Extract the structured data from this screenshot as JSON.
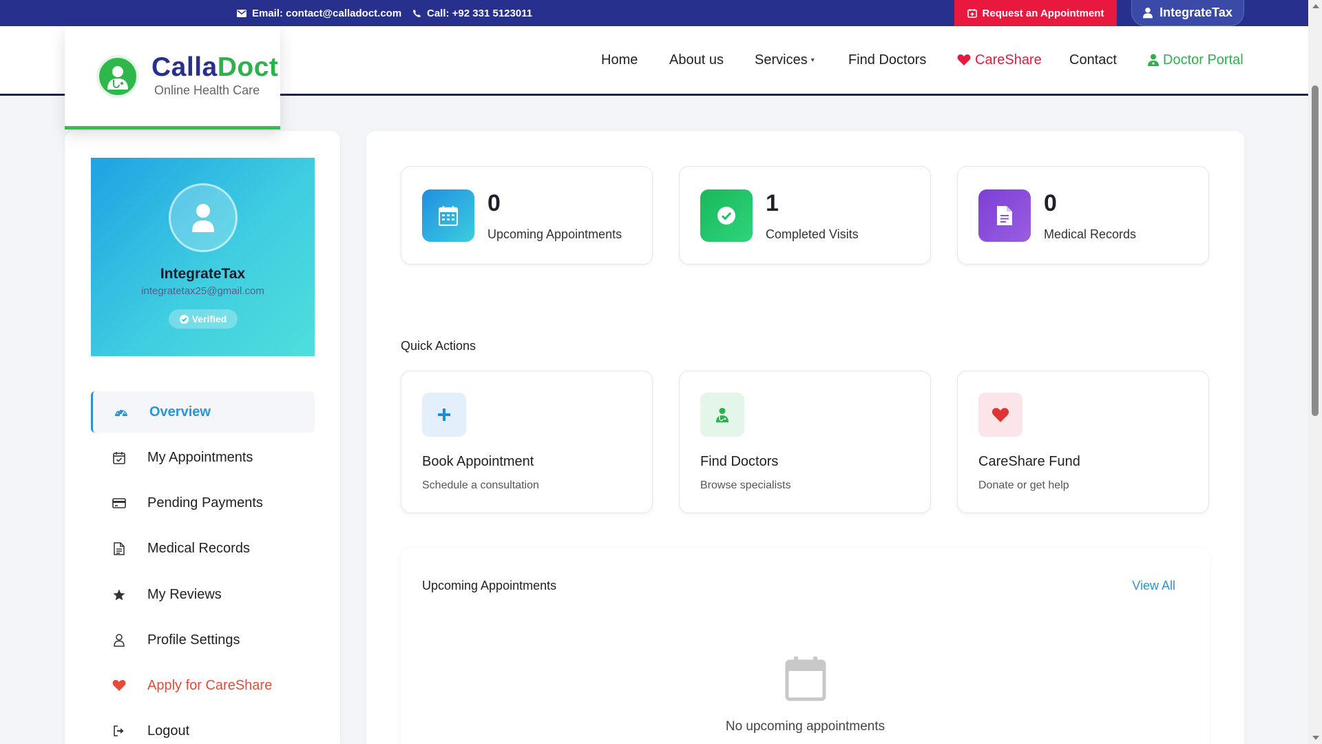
{
  "topbar": {
    "email_label": "Email: contact@calladoct.com",
    "call_label": "Call: +92 331 5123011",
    "request_label": "Request an Appointment",
    "user_label": "IntegrateTax"
  },
  "brand": {
    "name_part1": "Calla",
    "name_part2": "Doct",
    "tagline": "Online Health Care"
  },
  "nav": {
    "home": "Home",
    "about": "About us",
    "services": "Services",
    "services_caret": "▾",
    "find_doctors": "Find Doctors",
    "careshare": "CareShare",
    "contact": "Contact",
    "doctor_portal": "Doctor Portal"
  },
  "profile": {
    "name": "IntegrateTax",
    "email": "integratetax25@gmail.com",
    "badge": "Verified"
  },
  "sidebar": {
    "items": [
      {
        "label": "Overview",
        "icon": "dashboard-icon",
        "active": true
      },
      {
        "label": "My Appointments",
        "icon": "calendar-check-icon"
      },
      {
        "label": "Pending Payments",
        "icon": "credit-card-icon"
      },
      {
        "label": "Medical Records",
        "icon": "document-icon"
      },
      {
        "label": "My Reviews",
        "icon": "star-icon"
      },
      {
        "label": "Profile Settings",
        "icon": "user-icon"
      },
      {
        "label": "Apply for CareShare",
        "icon": "heart-icon"
      },
      {
        "label": "Logout",
        "icon": "logout-icon"
      }
    ]
  },
  "stats": [
    {
      "value": "0",
      "label": "Upcoming Appointments",
      "icon": "calendar-icon",
      "color": "#1fa2e2"
    },
    {
      "value": "1",
      "label": "Completed Visits",
      "icon": "check-circle-icon",
      "color": "#21c065"
    },
    {
      "value": "0",
      "label": "Medical Records",
      "icon": "file-icon",
      "color": "#8a4fd8"
    }
  ],
  "quick_actions": {
    "title": "Quick Actions",
    "items": [
      {
        "title": "Book Appointment",
        "subtitle": "Schedule a consultation",
        "icon": "plus-icon"
      },
      {
        "title": "Find Doctors",
        "subtitle": "Browse specialists",
        "icon": "doctor-icon"
      },
      {
        "title": "CareShare Fund",
        "subtitle": "Donate or get help",
        "icon": "heart-icon"
      }
    ]
  },
  "upcoming": {
    "title": "Upcoming Appointments",
    "view_all": "View All",
    "empty_text": "No upcoming appointments"
  },
  "colors": {
    "topbar": "#27318d",
    "accent_red": "#e8183f",
    "accent_green": "#2cb24b",
    "accent_blue": "#2a95d6"
  }
}
